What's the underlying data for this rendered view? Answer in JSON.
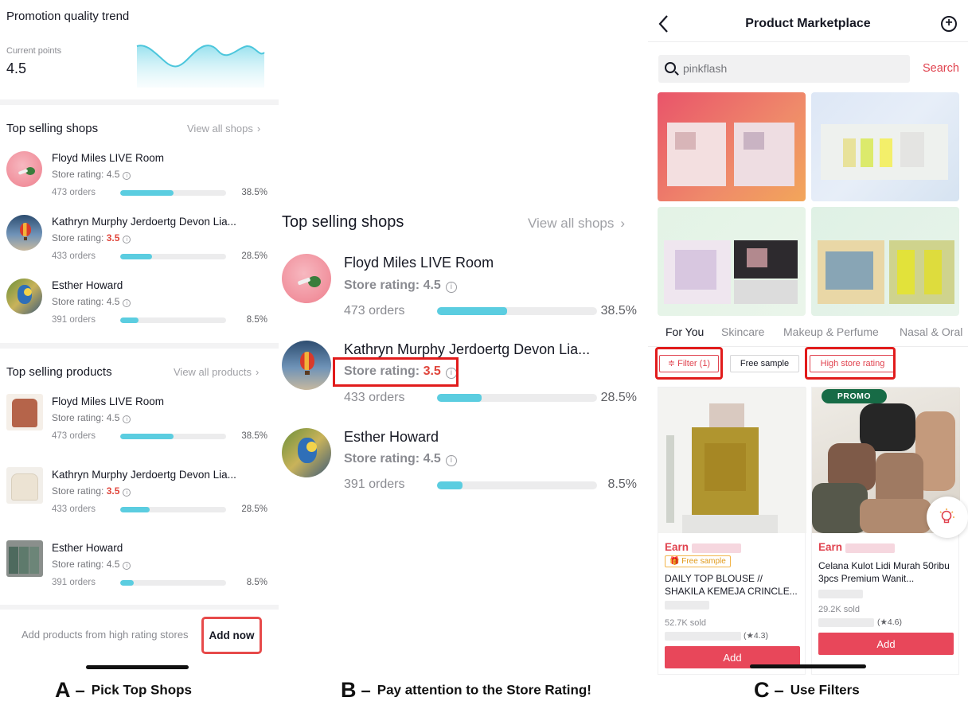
{
  "panel_a": {
    "trend_title": "Promotion quality trend",
    "points_label": "Current points",
    "points_value": "4.5",
    "shops_title": "Top selling shops",
    "shops_link": "View all shops",
    "shops": [
      {
        "name": "Floyd Miles LIVE Room",
        "rating_label": "Store rating:",
        "rating": "4.5",
        "orders": "473 orders",
        "pct": "38.5%",
        "fill": 0.5
      },
      {
        "name": "Kathryn Murphy Jerdoertg Devon Lia...",
        "rating_label": "Store rating:",
        "rating": "3.5",
        "orders": "433 orders",
        "pct": "28.5%",
        "fill": 0.3
      },
      {
        "name": "Esther Howard",
        "rating_label": "Store rating:",
        "rating": "4.5",
        "orders": "391 orders",
        "pct": "8.5%",
        "fill": 0.17
      }
    ],
    "products_title": "Top selling products",
    "products_link": "View all products",
    "products": [
      {
        "name": "Floyd Miles LIVE Room",
        "rating_label": "Store rating:",
        "rating": "4.5",
        "orders": "473 orders",
        "pct": "38.5%",
        "fill": 0.5
      },
      {
        "name": "Kathryn Murphy Jerdoertg Devon Lia...",
        "rating_label": "Store rating:",
        "rating": "3.5",
        "orders": "433 orders",
        "pct": "28.5%",
        "fill": 0.28
      },
      {
        "name": "Esther Howard",
        "rating_label": "Store rating:",
        "rating": "4.5",
        "orders": "391 orders",
        "pct": "8.5%",
        "fill": 0.13
      }
    ],
    "footer_text": "Add products from high rating stores",
    "add_now": "Add now"
  },
  "panel_b": {
    "title": "Top selling shops",
    "link": "View all shops",
    "shops": [
      {
        "name": "Floyd Miles LIVE Room",
        "rating_label": "Store rating:",
        "rating": "4.5",
        "orders": "473 orders",
        "pct": "38.5%",
        "fill": 0.44
      },
      {
        "name": "Kathryn Murphy Jerdoertg Devon Lia...",
        "rating_label": "Store rating:",
        "rating": "3.5",
        "orders": "433 orders",
        "pct": "28.5%",
        "fill": 0.28
      },
      {
        "name": "Esther Howard",
        "rating_label": "Store rating:",
        "rating": "4.5",
        "orders": "391 orders",
        "pct": "8.5%",
        "fill": 0.16
      }
    ]
  },
  "panel_c": {
    "title": "Product Marketplace",
    "search_value": "pinkflash",
    "search_button": "Search",
    "tabs": [
      "For You",
      "Skincare",
      "Makeup & Perfume",
      "Nasal & Oral"
    ],
    "chips": [
      "Filter (1)",
      "Free sample",
      "High store rating"
    ],
    "cards": [
      {
        "earn": "Earn",
        "badge": "Free sample",
        "title": "DAILY TOP BLOUSE // SHAKILA KEMEJA CRINCLE...",
        "sold": "52.7K sold",
        "rating": "(★4.3)",
        "add": "Add"
      },
      {
        "promo": "PROMO",
        "earn": "Earn",
        "title": "Celana Kulot Lidi Murah 50ribu 3pcs Premium Wanit...",
        "sold": "29.2K sold",
        "rating": "(★4.6)",
        "add": "Add"
      }
    ]
  },
  "captions": [
    {
      "letter": "A",
      "dash": "–",
      "text": "Pick Top Shops"
    },
    {
      "letter": "B",
      "dash": "–",
      "text": "Pay attention to the Store Rating!"
    },
    {
      "letter": "C",
      "dash": "–",
      "text": "Use Filters"
    }
  ],
  "colors": {
    "accent_red": "#e0424e",
    "bar_cyan": "#5bcde0",
    "low_rating": "#e0463c",
    "highlight_box": "#e11b1b"
  }
}
